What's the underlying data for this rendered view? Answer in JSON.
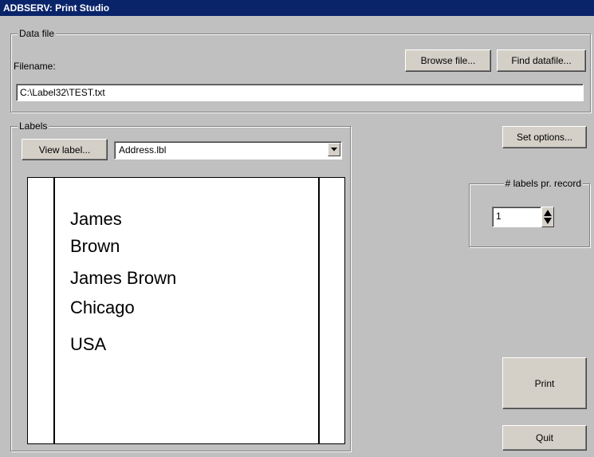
{
  "window": {
    "title": "ADBSERV: Print Studio"
  },
  "data_file": {
    "group_label": "Data file",
    "filename_label": "Filename:",
    "browse_button": "Browse file...",
    "find_button": "Find datafile...",
    "filename_value": "C:\\Label32\\TEST.txt"
  },
  "labels": {
    "group_label": "Labels",
    "view_button": "View label...",
    "selected_label": "Address.lbl",
    "preview_lines": [
      "James",
      "Brown",
      "James Brown",
      "Chicago",
      "USA"
    ]
  },
  "options": {
    "set_options_button": "Set options..."
  },
  "labels_per_record": {
    "group_label": "# labels pr. record",
    "value": "1"
  },
  "actions": {
    "print_button": "Print",
    "quit_button": "Quit"
  },
  "icons": {
    "dropdown": "chevron-down-icon",
    "spinner": "spinner-arrows-icon"
  }
}
